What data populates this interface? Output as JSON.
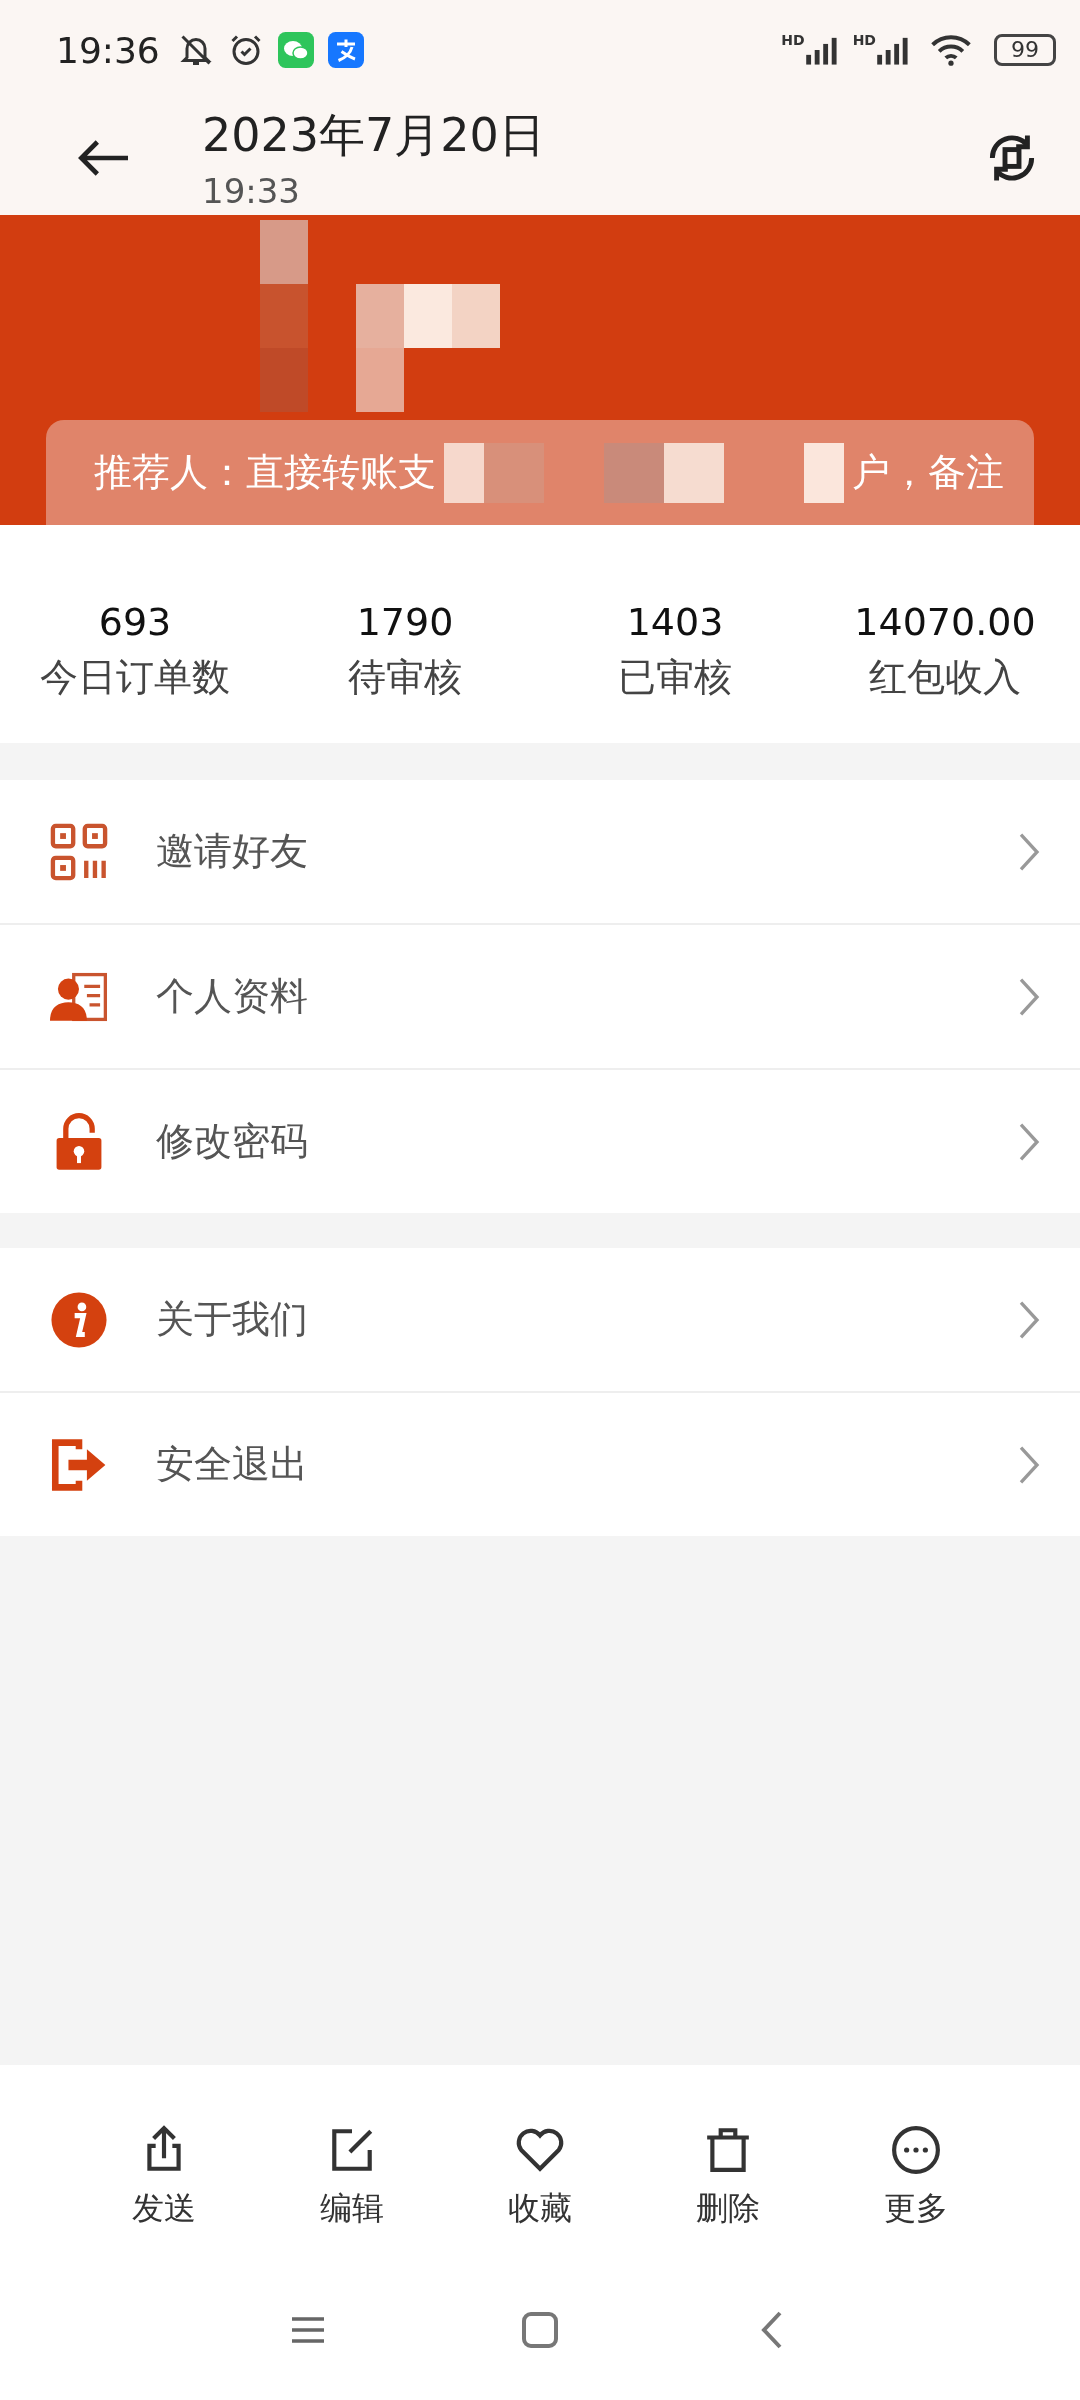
{
  "status_bar": {
    "time": "19:36",
    "signal_labels": [
      "HD",
      "HD"
    ],
    "battery": "99"
  },
  "header": {
    "title": "2023年7月20日",
    "subtitle": "19:33"
  },
  "banner": {
    "referrer_start": "推荐人：直接转账支",
    "referrer_end": "户，备注"
  },
  "stats": [
    {
      "value": "693",
      "label": "今日订单数"
    },
    {
      "value": "1790",
      "label": "待审核"
    },
    {
      "value": "1403",
      "label": "已审核"
    },
    {
      "value": "14070.00",
      "label": "红包收入"
    }
  ],
  "menu_groups": [
    [
      {
        "kind": "qr",
        "label": "邀请好友"
      },
      {
        "kind": "profile",
        "label": "个人资料"
      },
      {
        "kind": "lock",
        "label": "修改密码"
      }
    ],
    [
      {
        "kind": "info",
        "label": "关于我们"
      },
      {
        "kind": "logout",
        "label": "安全退出"
      }
    ]
  ],
  "actions": [
    {
      "kind": "share",
      "label": "发送"
    },
    {
      "kind": "edit",
      "label": "编辑"
    },
    {
      "kind": "heart",
      "label": "收藏"
    },
    {
      "kind": "trash",
      "label": "删除"
    },
    {
      "kind": "more",
      "label": "更多"
    }
  ]
}
